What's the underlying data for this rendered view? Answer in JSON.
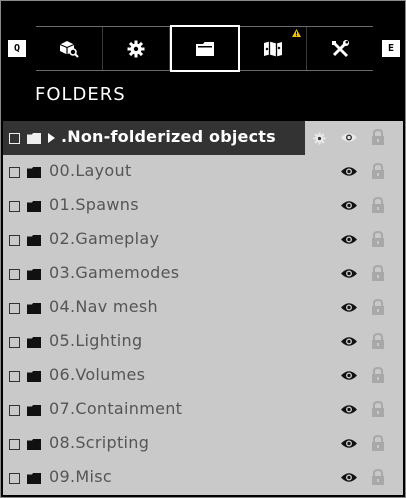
{
  "keys": {
    "left": "Q",
    "right": "E"
  },
  "tabs": [
    {
      "id": "objects",
      "icon": "cube-search-icon"
    },
    {
      "id": "settings",
      "icon": "gear-icon"
    },
    {
      "id": "folders",
      "icon": "folder-icon",
      "active": true
    },
    {
      "id": "map",
      "icon": "map-icon",
      "warning": true
    },
    {
      "id": "tools",
      "icon": "tools-icon"
    }
  ],
  "panel": {
    "title": "FOLDERS"
  },
  "folders": [
    {
      "name": ".Non-folderized objects",
      "selected": true
    },
    {
      "name": "00.Layout"
    },
    {
      "name": "01.Spawns"
    },
    {
      "name": "02.Gameplay"
    },
    {
      "name": "03.Gamemodes"
    },
    {
      "name": "04.Nav mesh"
    },
    {
      "name": "05.Lighting"
    },
    {
      "name": "06.Volumes"
    },
    {
      "name": "07.Containment"
    },
    {
      "name": "08.Scripting"
    },
    {
      "name": "09.Misc"
    }
  ],
  "colors": {
    "warning": "#f2c200",
    "selected_row": "#333333",
    "list_bg": "#c9c9c9"
  }
}
